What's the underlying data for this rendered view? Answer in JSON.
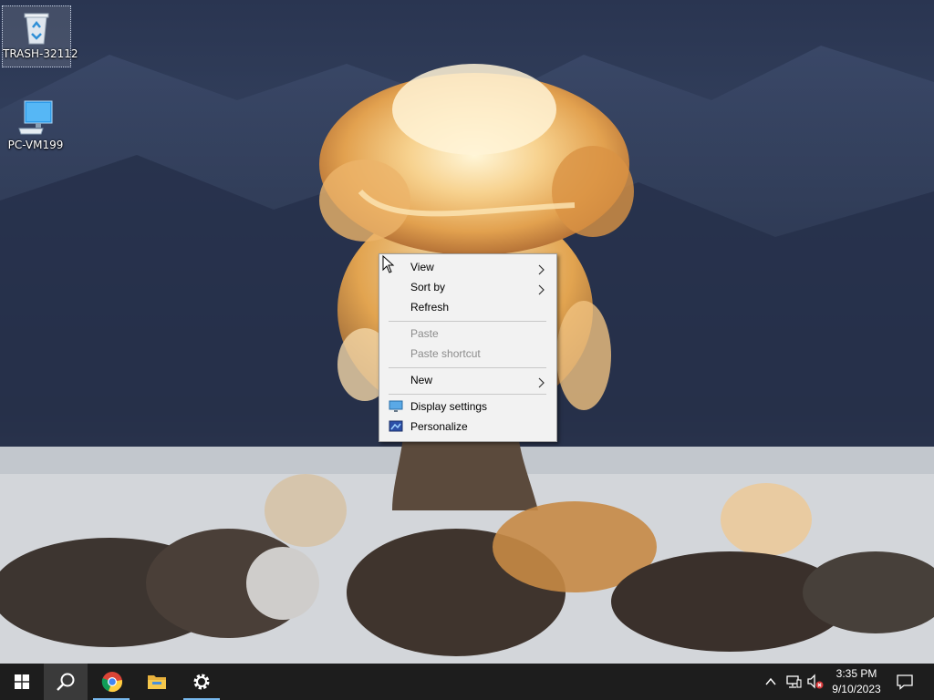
{
  "desktop": {
    "icons": [
      {
        "label": "TRASH-32112",
        "icon": "recycle-bin-icon"
      },
      {
        "label": "PC-VM199",
        "icon": "computer-icon"
      }
    ]
  },
  "context_menu": {
    "view": "View",
    "sort_by": "Sort by",
    "refresh": "Refresh",
    "paste": "Paste",
    "paste_shortcut": "Paste shortcut",
    "new": "New",
    "display_settings": "Display settings",
    "personalize": "Personalize"
  },
  "taskbar": {
    "apps": [
      "start-icon",
      "search-icon",
      "chrome-icon",
      "file-explorer-icon",
      "settings-icon"
    ],
    "tray": [
      "chevron-up-icon",
      "network-icon",
      "volume-muted-icon",
      "notification-icon"
    ],
    "time": "3:35 PM",
    "date": "9/10/2023"
  },
  "colors": {
    "taskbar": "#1d1d1d",
    "menu_background": "#f2f2f2",
    "active_underline": "#77b9ee"
  }
}
